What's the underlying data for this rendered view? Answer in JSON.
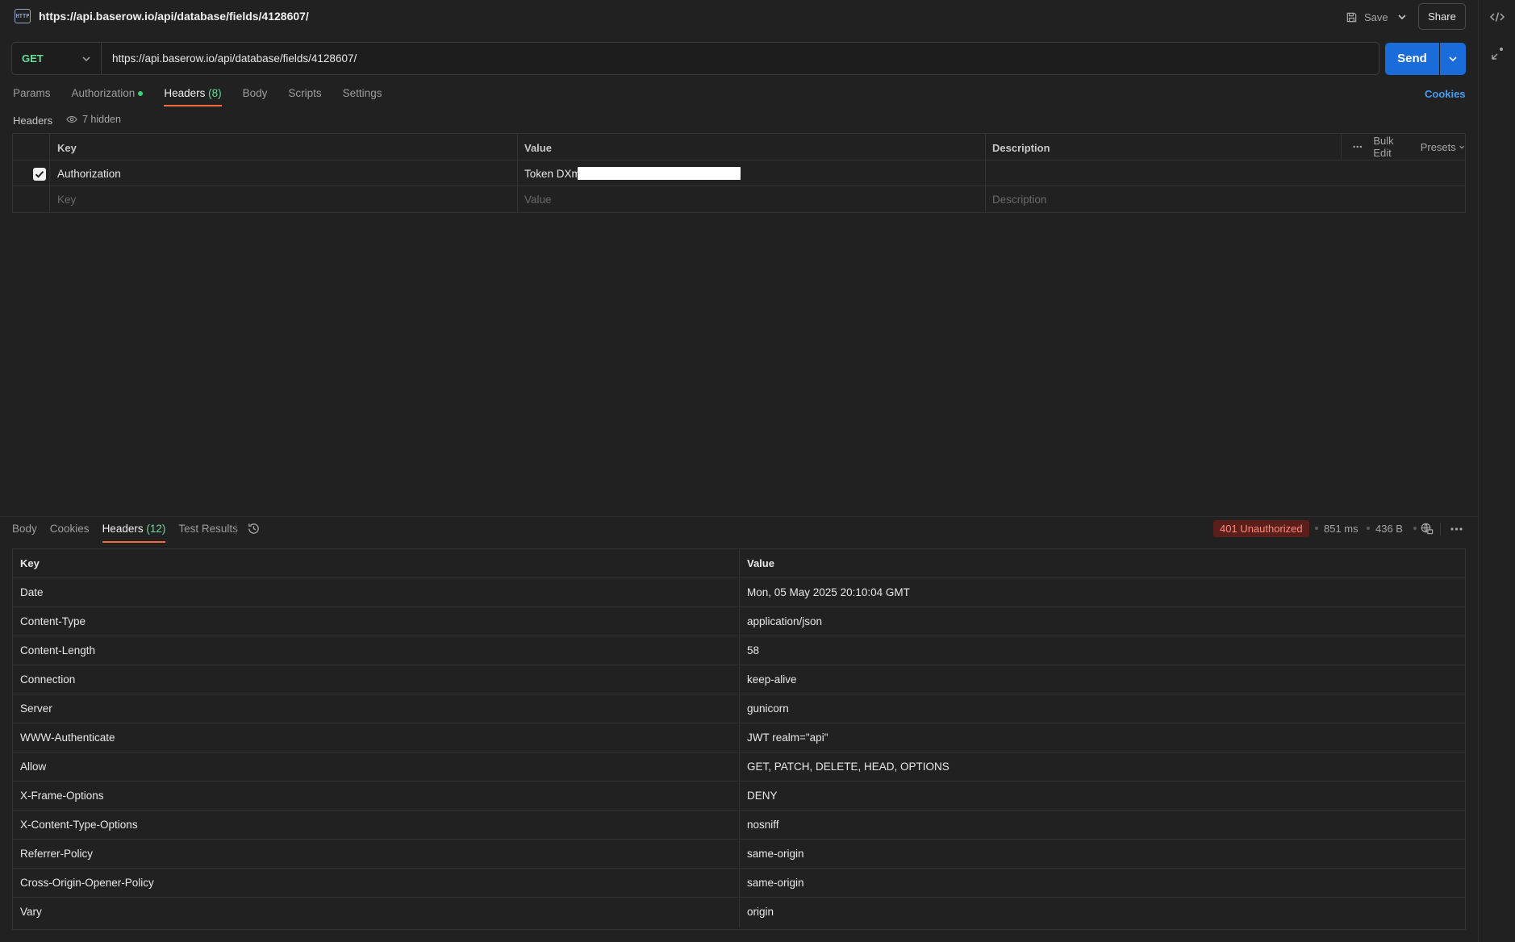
{
  "header": {
    "title": "https://api.baserow.io/api/database/fields/4128607/",
    "save_label": "Save",
    "share_label": "Share",
    "http_icon_text": "HTTP"
  },
  "request": {
    "method": "GET",
    "url": "https://api.baserow.io/api/database/fields/4128607/",
    "send_label": "Send"
  },
  "req_tabs": {
    "params": "Params",
    "authorization": "Authorization",
    "headers": "Headers",
    "headers_count": "(8)",
    "body": "Body",
    "scripts": "Scripts",
    "settings": "Settings",
    "cookies": "Cookies"
  },
  "headers_section": {
    "label": "Headers",
    "hidden": "7 hidden"
  },
  "req_table": {
    "col_key": "Key",
    "col_value": "Value",
    "col_description": "Description",
    "bulk_edit": "Bulk Edit",
    "presets": "Presets",
    "row_key": "Authorization",
    "row_value": "Token DXm",
    "row_checked": true,
    "placeholder_key": "Key",
    "placeholder_value": "Value",
    "placeholder_description": "Description"
  },
  "resp_tabs": {
    "body": "Body",
    "cookies": "Cookies",
    "headers": "Headers",
    "headers_count": "(12)",
    "test_results": "Test Results"
  },
  "response": {
    "status": "401 Unauthorized",
    "time": "851 ms",
    "size": "436 B",
    "status_color": "#ff8a7a"
  },
  "resp_table": {
    "col_key": "Key",
    "col_value": "Value",
    "rows": [
      {
        "key": "Date",
        "value": "Mon, 05 May 2025 20:10:04 GMT"
      },
      {
        "key": "Content-Type",
        "value": "application/json"
      },
      {
        "key": "Content-Length",
        "value": "58"
      },
      {
        "key": "Connection",
        "value": "keep-alive"
      },
      {
        "key": "Server",
        "value": "gunicorn"
      },
      {
        "key": "WWW-Authenticate",
        "value": "JWT realm=\"api\""
      },
      {
        "key": "Allow",
        "value": "GET, PATCH, DELETE, HEAD, OPTIONS"
      },
      {
        "key": "X-Frame-Options",
        "value": "DENY"
      },
      {
        "key": "X-Content-Type-Options",
        "value": "nosniff"
      },
      {
        "key": "Referrer-Policy",
        "value": "same-origin"
      },
      {
        "key": "Cross-Origin-Opener-Policy",
        "value": "same-origin"
      },
      {
        "key": "Vary",
        "value": "origin"
      }
    ]
  }
}
